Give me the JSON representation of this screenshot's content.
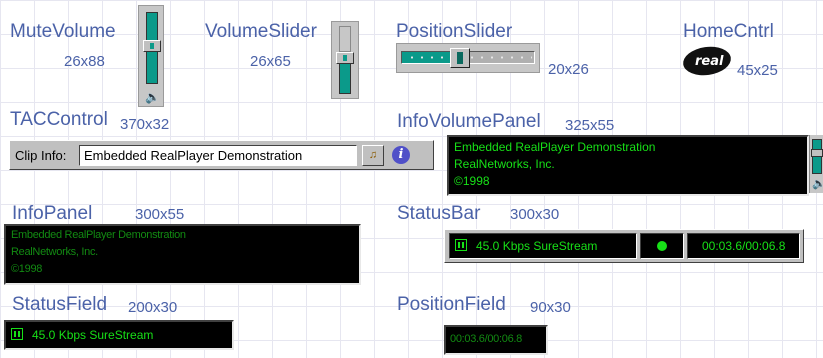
{
  "components": {
    "mute_volume": {
      "name": "MuteVolume",
      "size": "26x88"
    },
    "volume_slider": {
      "name": "VolumeSlider",
      "size": "26x65"
    },
    "position_slider": {
      "name": "PositionSlider",
      "size": "20x26"
    },
    "home_control": {
      "name": "HomeCntrl",
      "size": "45x25",
      "logo_text": "real"
    },
    "tac_control": {
      "name": "TACControl",
      "size": "370x32",
      "label": "Clip Info:",
      "field_value": "Embedded RealPlayer Demonstration",
      "info_glyph": "i"
    },
    "info_volume_panel": {
      "name": "InfoVolumePanel",
      "size": "325x55",
      "lines": [
        "Embedded RealPlayer Demonstration",
        "RealNetworks, Inc.",
        "©1998"
      ]
    },
    "info_panel": {
      "name": "InfoPanel",
      "size": "300x55",
      "lines": [
        "Embedded RealPlayer Demonstration",
        "RealNetworks, Inc.",
        "©1998"
      ]
    },
    "status_bar": {
      "name": "StatusBar",
      "size": "300x30",
      "status_text": "45.0 Kbps SureStream",
      "time_text": "00:03.6/00:06.8"
    },
    "status_field": {
      "name": "StatusField",
      "size": "200x30",
      "status_text": "45.0 Kbps SureStream"
    },
    "position_field": {
      "name": "PositionField",
      "size": "90x30",
      "time_text": "00:03.6/00:06.8"
    }
  },
  "levels": {
    "mute_volume_level": 0.55,
    "volume_slider_level": 0.6,
    "position_slider_progress": 0.36
  },
  "colors": {
    "label": "#4b62a8",
    "led_green": "#17e017",
    "slider_teal": "#0b9a8a"
  }
}
